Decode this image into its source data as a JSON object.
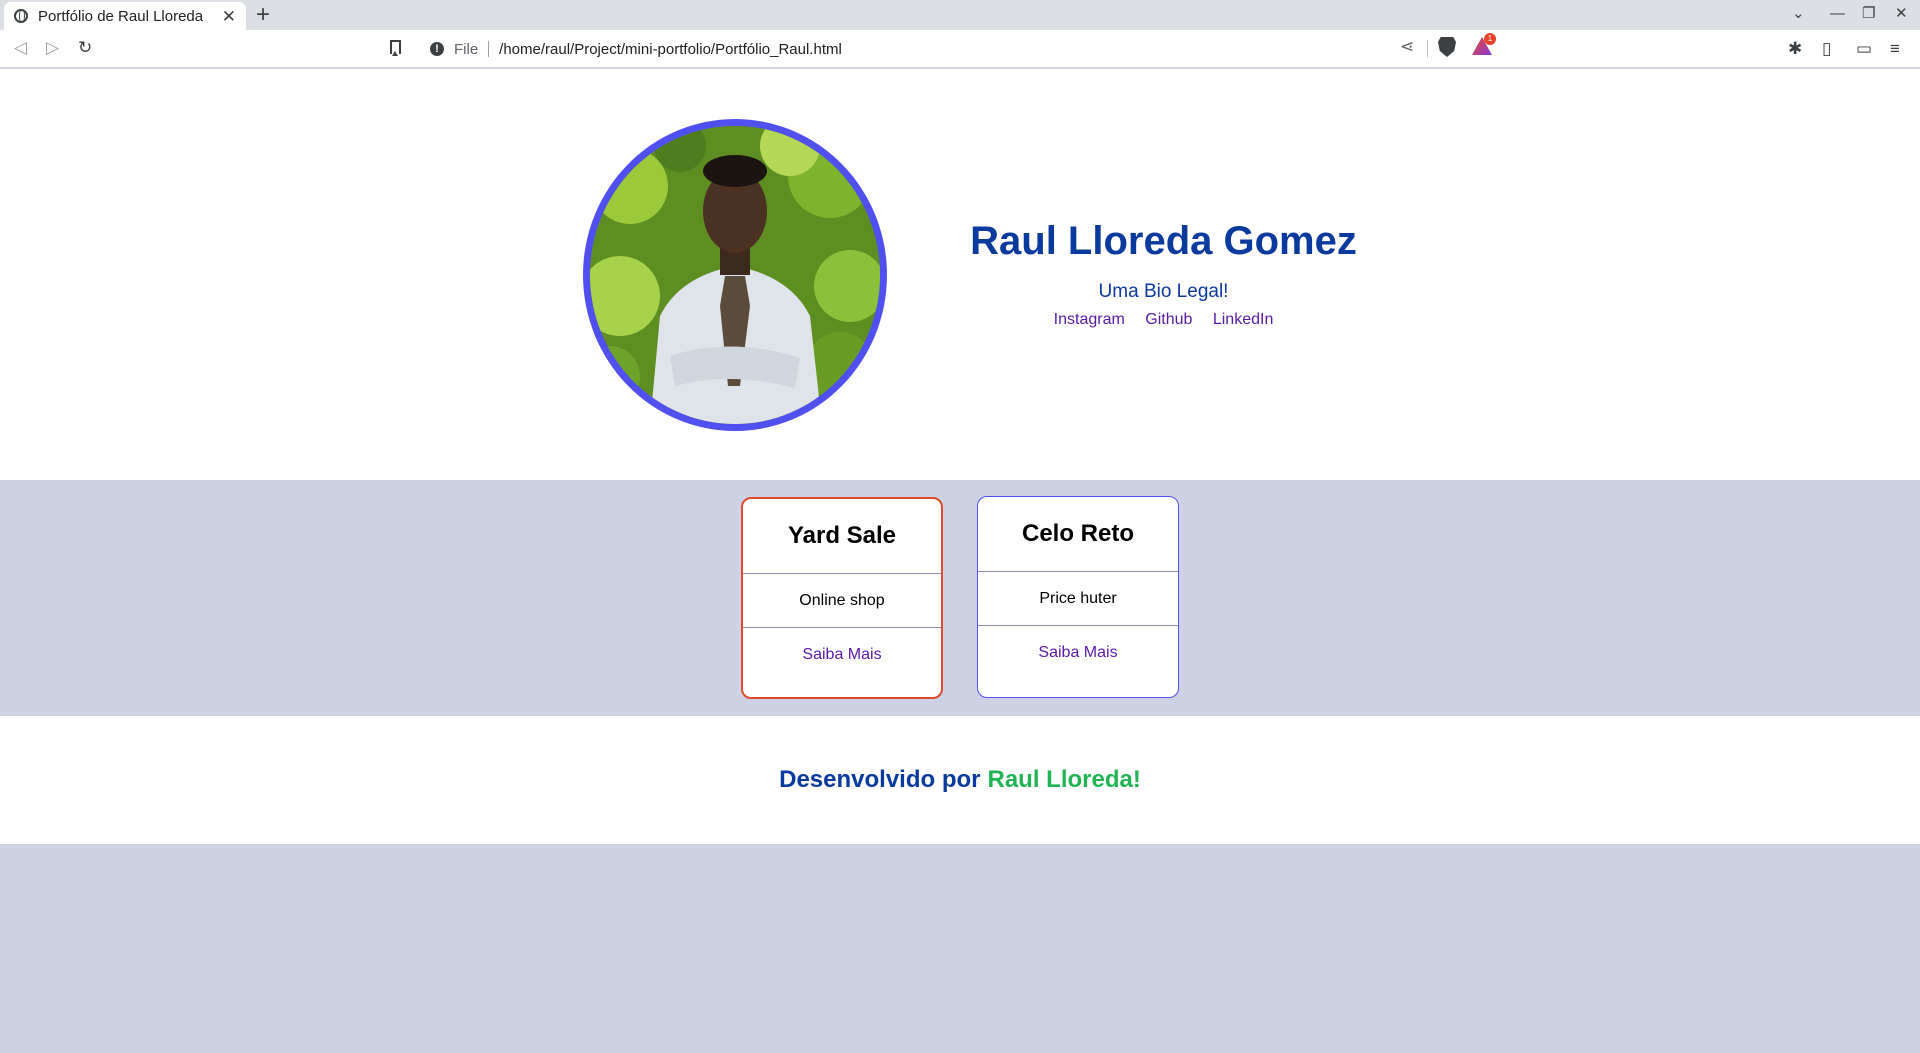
{
  "browser": {
    "tab_title": "Portfólio de Raul Lloreda",
    "tab_close": "✕",
    "new_tab": "+",
    "url_scheme_label": "File",
    "url": "/home/raul/Project/mini-portfolio/Portfólio_Raul.html",
    "rewards_badge": "1",
    "icons": {
      "back": "◁",
      "forward": "▷",
      "reload": "↻",
      "share": "⋖",
      "extensions": "✱",
      "sidebar": "▯",
      "wallet": "▭",
      "menu": "≡",
      "tab_list": "⌄",
      "minimize": "—",
      "restore": "❐",
      "close_window": "✕"
    }
  },
  "profile": {
    "name": "Raul Lloreda Gomez",
    "bio": "Uma Bio Legal!",
    "links": [
      "Instagram",
      "Github",
      "LinkedIn"
    ],
    "avatar_border_color": "#5050f0"
  },
  "cards": [
    {
      "title": "Yard Sale",
      "description": "Online shop",
      "link": "Saiba Mais",
      "border_color": "#e04a2a"
    },
    {
      "title": "Celo Reto",
      "description": "Price huter",
      "link": "Saiba Mais",
      "border_color": "#5050f0"
    }
  ],
  "footer": {
    "prefix": "Desenvolvido por",
    "author": "Raul Lloreda!"
  },
  "colors": {
    "heading": "#0a3a9e",
    "link": "#5a1aa8",
    "author": "#22b454",
    "page_background": "#cdd3e4"
  }
}
